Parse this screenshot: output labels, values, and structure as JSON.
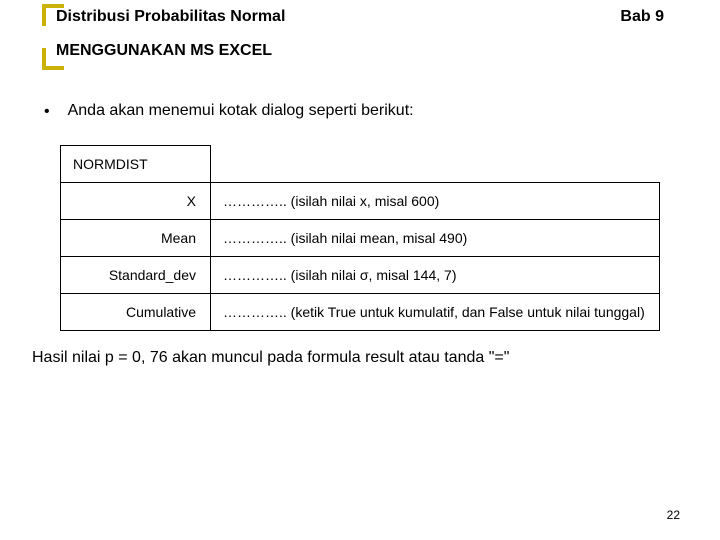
{
  "header": {
    "title": "Distribusi Probabilitas Normal",
    "chapter": "Bab 9"
  },
  "section_title": "MENGGUNAKAN MS EXCEL",
  "bullet": {
    "marker": "•",
    "text": "Anda akan menemui kotak dialog seperti berikut:"
  },
  "table": {
    "func": "NORMDIST",
    "rows": [
      {
        "label": "X",
        "value": "………….. (isilah nilai x, misal 600)"
      },
      {
        "label": "Mean",
        "value": "………….. (isilah nilai mean, misal 490)"
      },
      {
        "label": "Standard_dev",
        "value": "………….. (isilah nilai σ, misal 144, 7)"
      },
      {
        "label": "Cumulative",
        "value": "………….. (ketik True untuk kumulatif, dan False untuk nilai tunggal)"
      }
    ]
  },
  "result": "Hasil nilai p = 0, 76 akan muncul pada formula result atau tanda \"=\"",
  "pagenum": "22"
}
